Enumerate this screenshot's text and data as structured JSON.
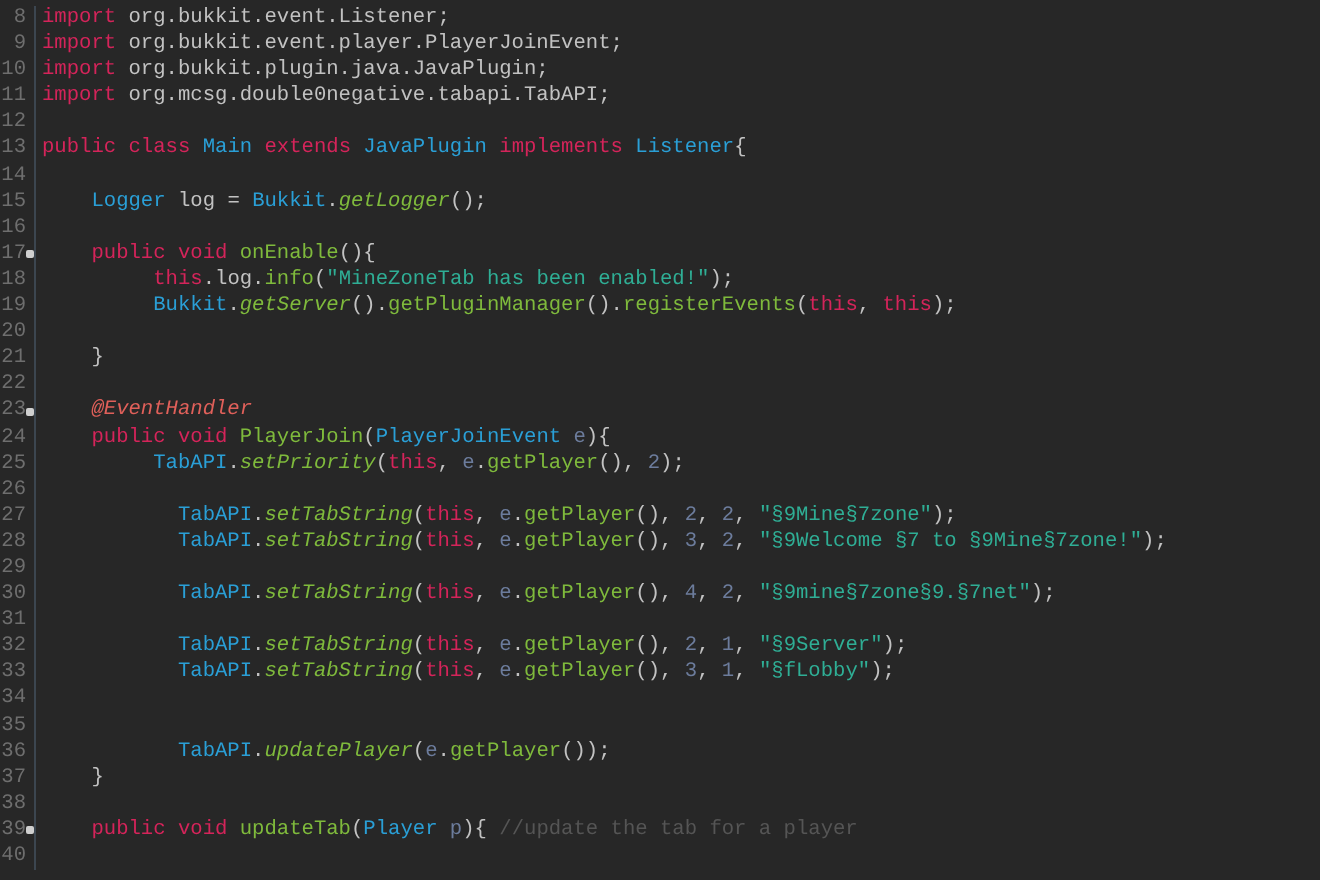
{
  "editor": {
    "lines": [
      {
        "number": "8",
        "fold": false,
        "tokens": [
          {
            "kind": "kw",
            "t": "import"
          },
          {
            "kind": "plain",
            "t": " org.bukkit.event.Listener;"
          }
        ]
      },
      {
        "number": "9",
        "fold": false,
        "tokens": [
          {
            "kind": "kw",
            "t": "import"
          },
          {
            "kind": "plain",
            "t": " org.bukkit.event.player.PlayerJoinEvent;"
          }
        ]
      },
      {
        "number": "10",
        "fold": false,
        "tokens": [
          {
            "kind": "kw",
            "t": "import"
          },
          {
            "kind": "plain",
            "t": " org.bukkit.plugin.java.JavaPlugin;"
          }
        ]
      },
      {
        "number": "11",
        "fold": false,
        "tokens": [
          {
            "kind": "kw",
            "t": "import"
          },
          {
            "kind": "plain",
            "t": " org.mcsg.double0negative.tabapi.TabAPI;"
          }
        ]
      },
      {
        "number": "12",
        "fold": false
      },
      {
        "number": "13",
        "fold": false,
        "tokens": [
          {
            "kind": "kw",
            "t": "public class"
          },
          {
            "kind": "type",
            "t": " Main"
          },
          {
            "kind": "kw",
            "t": " extends"
          },
          {
            "kind": "type",
            "t": " JavaPlugin"
          },
          {
            "kind": "kw",
            "t": " implements"
          },
          {
            "kind": "type",
            "t": " Listener"
          },
          {
            "kind": "plain",
            "t": "{"
          }
        ]
      },
      {
        "number": "14",
        "fold": false
      },
      {
        "number": "15",
        "fold": false,
        "tokens": [
          {
            "kind": "type",
            "t": "    Logger"
          },
          {
            "kind": "plain",
            "t": " log = "
          },
          {
            "kind": "type",
            "t": "Bukkit"
          },
          {
            "kind": "plain",
            "t": "."
          },
          {
            "kind": "call",
            "t": "getLogger"
          },
          {
            "kind": "plain",
            "t": "();"
          }
        ]
      },
      {
        "number": "16",
        "fold": false
      },
      {
        "number": "17",
        "fold": true,
        "tokens": [
          {
            "kind": "kw",
            "t": "    public void"
          },
          {
            "kind": "method",
            "t": " onEnable"
          },
          {
            "kind": "plain",
            "t": "(){"
          }
        ]
      },
      {
        "number": "18",
        "fold": false,
        "tokens": [
          {
            "kind": "kw",
            "t": "         this"
          },
          {
            "kind": "plain",
            "t": ".log."
          },
          {
            "kind": "method",
            "t": "info"
          },
          {
            "kind": "plain",
            "t": "("
          },
          {
            "kind": "string",
            "t": "\"MineZoneTab has been enabled!\""
          },
          {
            "kind": "plain",
            "t": ");"
          }
        ]
      },
      {
        "number": "19",
        "fold": false,
        "tokens": [
          {
            "kind": "type",
            "t": "         Bukkit"
          },
          {
            "kind": "plain",
            "t": "."
          },
          {
            "kind": "call",
            "t": "getServer"
          },
          {
            "kind": "plain",
            "t": "()."
          },
          {
            "kind": "method",
            "t": "getPluginManager"
          },
          {
            "kind": "plain",
            "t": "()."
          },
          {
            "kind": "method",
            "t": "registerEvents"
          },
          {
            "kind": "plain",
            "t": "("
          },
          {
            "kind": "kw",
            "t": "this"
          },
          {
            "kind": "plain",
            "t": ", "
          },
          {
            "kind": "kw",
            "t": "this"
          },
          {
            "kind": "plain",
            "t": ");"
          }
        ]
      },
      {
        "number": "20",
        "fold": false
      },
      {
        "number": "21",
        "fold": false,
        "tokens": [
          {
            "kind": "plain",
            "t": "    }"
          }
        ]
      },
      {
        "number": "22",
        "fold": false
      },
      {
        "number": "23",
        "fold": true,
        "tokens": [
          {
            "kind": "annotation",
            "t": "    @EventHandler"
          }
        ]
      },
      {
        "number": "24",
        "fold": false,
        "tokens": [
          {
            "kind": "kw",
            "t": "    public void"
          },
          {
            "kind": "method",
            "t": " PlayerJoin"
          },
          {
            "kind": "plain",
            "t": "("
          },
          {
            "kind": "type",
            "t": "PlayerJoinEvent"
          },
          {
            "kind": "var",
            "t": " e"
          },
          {
            "kind": "plain",
            "t": "){"
          }
        ]
      },
      {
        "number": "25",
        "fold": false,
        "tokens": [
          {
            "kind": "type",
            "t": "         TabAPI"
          },
          {
            "kind": "plain",
            "t": "."
          },
          {
            "kind": "call",
            "t": "setPriority"
          },
          {
            "kind": "plain",
            "t": "("
          },
          {
            "kind": "kw",
            "t": "this"
          },
          {
            "kind": "plain",
            "t": ", "
          },
          {
            "kind": "var",
            "t": "e"
          },
          {
            "kind": "plain",
            "t": "."
          },
          {
            "kind": "method",
            "t": "getPlayer"
          },
          {
            "kind": "plain",
            "t": "(), "
          },
          {
            "kind": "num",
            "t": "2"
          },
          {
            "kind": "plain",
            "t": ");"
          }
        ]
      },
      {
        "number": "26",
        "fold": false
      },
      {
        "number": "27",
        "fold": false,
        "tokens": [
          {
            "kind": "type",
            "t": "           TabAPI"
          },
          {
            "kind": "plain",
            "t": "."
          },
          {
            "kind": "call",
            "t": "setTabString"
          },
          {
            "kind": "plain",
            "t": "("
          },
          {
            "kind": "kw",
            "t": "this"
          },
          {
            "kind": "plain",
            "t": ", "
          },
          {
            "kind": "var",
            "t": "e"
          },
          {
            "kind": "plain",
            "t": "."
          },
          {
            "kind": "method",
            "t": "getPlayer"
          },
          {
            "kind": "plain",
            "t": "(), "
          },
          {
            "kind": "num",
            "t": "2"
          },
          {
            "kind": "plain",
            "t": ", "
          },
          {
            "kind": "num",
            "t": "2"
          },
          {
            "kind": "plain",
            "t": ", "
          },
          {
            "kind": "string",
            "t": "\"§9Mine§7zone\""
          },
          {
            "kind": "plain",
            "t": ");"
          }
        ]
      },
      {
        "number": "28",
        "fold": false,
        "tokens": [
          {
            "kind": "type",
            "t": "           TabAPI"
          },
          {
            "kind": "plain",
            "t": "."
          },
          {
            "kind": "call",
            "t": "setTabString"
          },
          {
            "kind": "plain",
            "t": "("
          },
          {
            "kind": "kw",
            "t": "this"
          },
          {
            "kind": "plain",
            "t": ", "
          },
          {
            "kind": "var",
            "t": "e"
          },
          {
            "kind": "plain",
            "t": "."
          },
          {
            "kind": "method",
            "t": "getPlayer"
          },
          {
            "kind": "plain",
            "t": "(), "
          },
          {
            "kind": "num",
            "t": "3"
          },
          {
            "kind": "plain",
            "t": ", "
          },
          {
            "kind": "num",
            "t": "2"
          },
          {
            "kind": "plain",
            "t": ", "
          },
          {
            "kind": "string",
            "t": "\"§9Welcome §7 to §9Mine§7zone!\""
          },
          {
            "kind": "plain",
            "t": ");"
          }
        ]
      },
      {
        "number": "29",
        "fold": false
      },
      {
        "number": "30",
        "fold": false,
        "tokens": [
          {
            "kind": "type",
            "t": "           TabAPI"
          },
          {
            "kind": "plain",
            "t": "."
          },
          {
            "kind": "call",
            "t": "setTabString"
          },
          {
            "kind": "plain",
            "t": "("
          },
          {
            "kind": "kw",
            "t": "this"
          },
          {
            "kind": "plain",
            "t": ", "
          },
          {
            "kind": "var",
            "t": "e"
          },
          {
            "kind": "plain",
            "t": "."
          },
          {
            "kind": "method",
            "t": "getPlayer"
          },
          {
            "kind": "plain",
            "t": "(), "
          },
          {
            "kind": "num",
            "t": "4"
          },
          {
            "kind": "plain",
            "t": ", "
          },
          {
            "kind": "num",
            "t": "2"
          },
          {
            "kind": "plain",
            "t": ", "
          },
          {
            "kind": "string",
            "t": "\"§9mine§7zone§9.§7net\""
          },
          {
            "kind": "plain",
            "t": ");"
          }
        ]
      },
      {
        "number": "31",
        "fold": false
      },
      {
        "number": "32",
        "fold": false,
        "tokens": [
          {
            "kind": "type",
            "t": "           TabAPI"
          },
          {
            "kind": "plain",
            "t": "."
          },
          {
            "kind": "call",
            "t": "setTabString"
          },
          {
            "kind": "plain",
            "t": "("
          },
          {
            "kind": "kw",
            "t": "this"
          },
          {
            "kind": "plain",
            "t": ", "
          },
          {
            "kind": "var",
            "t": "e"
          },
          {
            "kind": "plain",
            "t": "."
          },
          {
            "kind": "method",
            "t": "getPlayer"
          },
          {
            "kind": "plain",
            "t": "(), "
          },
          {
            "kind": "num",
            "t": "2"
          },
          {
            "kind": "plain",
            "t": ", "
          },
          {
            "kind": "num",
            "t": "1"
          },
          {
            "kind": "plain",
            "t": ", "
          },
          {
            "kind": "string",
            "t": "\"§9Server\""
          },
          {
            "kind": "plain",
            "t": ");"
          }
        ]
      },
      {
        "number": "33",
        "fold": false,
        "tokens": [
          {
            "kind": "type",
            "t": "           TabAPI"
          },
          {
            "kind": "plain",
            "t": "."
          },
          {
            "kind": "call",
            "t": "setTabString"
          },
          {
            "kind": "plain",
            "t": "("
          },
          {
            "kind": "kw",
            "t": "this"
          },
          {
            "kind": "plain",
            "t": ", "
          },
          {
            "kind": "var",
            "t": "e"
          },
          {
            "kind": "plain",
            "t": "."
          },
          {
            "kind": "method",
            "t": "getPlayer"
          },
          {
            "kind": "plain",
            "t": "(), "
          },
          {
            "kind": "num",
            "t": "3"
          },
          {
            "kind": "plain",
            "t": ", "
          },
          {
            "kind": "num",
            "t": "1"
          },
          {
            "kind": "plain",
            "t": ", "
          },
          {
            "kind": "string",
            "t": "\"§fLobby\""
          },
          {
            "kind": "plain",
            "t": ");"
          }
        ]
      },
      {
        "number": "34",
        "fold": false
      },
      {
        "number": "35",
        "fold": false
      },
      {
        "number": "36",
        "fold": false,
        "tokens": [
          {
            "kind": "type",
            "t": "           TabAPI"
          },
          {
            "kind": "plain",
            "t": "."
          },
          {
            "kind": "call",
            "t": "updatePlayer"
          },
          {
            "kind": "plain",
            "t": "("
          },
          {
            "kind": "var",
            "t": "e"
          },
          {
            "kind": "plain",
            "t": "."
          },
          {
            "kind": "method",
            "t": "getPlayer"
          },
          {
            "kind": "plain",
            "t": "());"
          }
        ]
      },
      {
        "number": "37",
        "fold": false,
        "tokens": [
          {
            "kind": "plain",
            "t": "    }"
          }
        ]
      },
      {
        "number": "38",
        "fold": false
      },
      {
        "number": "39",
        "fold": true,
        "tokens": [
          {
            "kind": "kw",
            "t": "    public void"
          },
          {
            "kind": "method",
            "t": " updateTab"
          },
          {
            "kind": "plain",
            "t": "("
          },
          {
            "kind": "type",
            "t": "Player"
          },
          {
            "kind": "var",
            "t": " p"
          },
          {
            "kind": "plain",
            "t": "){ "
          },
          {
            "kind": "comment",
            "t": "//update the tab for a player"
          }
        ]
      },
      {
        "number": "40",
        "fold": false
      }
    ]
  }
}
